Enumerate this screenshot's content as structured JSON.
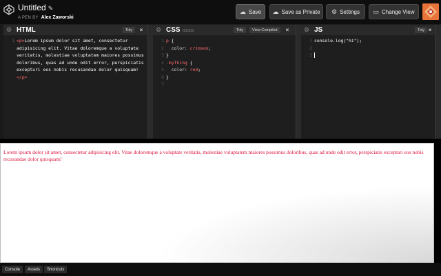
{
  "header": {
    "title": "Untitled",
    "edit_icon": "pencil-icon",
    "byline_prefix": "A PEN BY",
    "author": "Alex Zaworski",
    "buttons": {
      "save": "Save",
      "save_private": "Save as Private",
      "settings": "Settings",
      "change_view": "Change View"
    }
  },
  "editors": {
    "html": {
      "title": "HTML",
      "tidy": "Tidy",
      "line_numbers": [
        "1"
      ],
      "code_open_tag": "<p>",
      "code_text": "Lorem ipsum dolor sit amet, consectetur adipisicing elit. Vitae doloremque a voluptate veritatis, molestiae voluptatem maiores possimus doloribus, quas ad unde odit error, perspiciatis excepturi eos nobis recusandae dolor quisquam!",
      "code_close_tag": "</p>"
    },
    "css": {
      "title": "CSS",
      "preprocessor": "(SCSS)",
      "tidy": "Tidy",
      "view_compiled": "View Compiled",
      "line_numbers": [
        "1",
        "2",
        "3",
        "4",
        "5",
        "6",
        "7"
      ],
      "lines": {
        "l1_sel": "p",
        "l1_rest": " {",
        "l2_prop": "  color: ",
        "l2_val": "crimson",
        "l2_end": ";",
        "l3": "}",
        "l4": "",
        "l5_sel": ".myThing",
        "l5_rest": " {",
        "l6_prop": "  color: ",
        "l6_val": "red",
        "l6_end": ";",
        "l7": "}"
      }
    },
    "js": {
      "title": "JS",
      "tidy": "Tidy",
      "line_numbers": [
        "1",
        "2",
        "3"
      ],
      "line1": "console.log(\"hi\");"
    }
  },
  "preview": {
    "text": "Lorem ipsum dolor sit amet, consectetur adipisicing elit. Vitae doloremque a voluptate veritatis, molestiae voluptatem maiores possimus doloribus, quas ad unde odit error, perspiciatis excepturi eos nobis recusandae dolor quisquam!"
  },
  "footer": {
    "console": "Console",
    "assets": "Assets",
    "shortcuts": "Shortcuts"
  },
  "colors": {
    "accent_text": "#dc143c",
    "avatar": "#e8743b"
  }
}
